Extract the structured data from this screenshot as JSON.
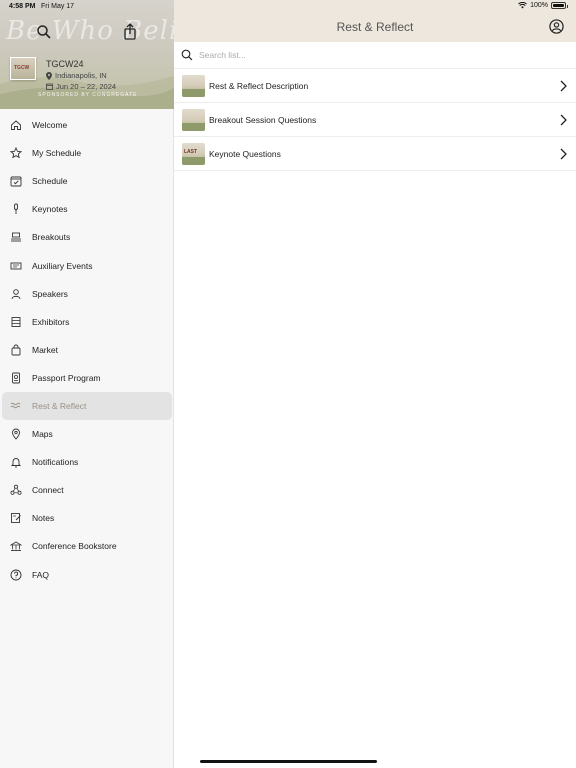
{
  "status_bar": {
    "time": "4:58 PM",
    "date": "Fri May 17",
    "battery": "100%",
    "battery_level": 1.0,
    "wifi_icon": "wifi-icon",
    "battery_icon": "battery-icon"
  },
  "sidebar": {
    "banner": {
      "script_text": "Be Who Believe",
      "conference_name": "TGCW24",
      "location": "Indianapolis, IN",
      "dates": "Jun 20 – 22, 2024",
      "sponsor": "SPONSORED BY CONGREGATE"
    },
    "items": [
      {
        "label": "Welcome",
        "icon": "home-icon"
      },
      {
        "label": "My Schedule",
        "icon": "star-icon"
      },
      {
        "label": "Schedule",
        "icon": "calendar-check-icon"
      },
      {
        "label": "Keynotes",
        "icon": "microphone-icon"
      },
      {
        "label": "Breakouts",
        "icon": "podium-icon"
      },
      {
        "label": "Auxiliary Events",
        "icon": "ticket-icon"
      },
      {
        "label": "Speakers",
        "icon": "person-icon"
      },
      {
        "label": "Exhibitors",
        "icon": "booth-icon"
      },
      {
        "label": "Market",
        "icon": "shopping-bag-icon"
      },
      {
        "label": "Passport Program",
        "icon": "passport-icon"
      },
      {
        "label": "Rest & Reflect",
        "icon": "waves-icon",
        "active": true
      },
      {
        "label": "Maps",
        "icon": "map-pin-icon"
      },
      {
        "label": "Notifications",
        "icon": "bell-icon"
      },
      {
        "label": "Connect",
        "icon": "connect-icon"
      },
      {
        "label": "Notes",
        "icon": "notes-icon"
      },
      {
        "label": "Conference Bookstore",
        "icon": "bookstore-icon"
      },
      {
        "label": "FAQ",
        "icon": "question-icon"
      }
    ]
  },
  "main": {
    "title": "Rest & Reflect",
    "search": {
      "placeholder": "Search list...",
      "value": ""
    },
    "rows": [
      {
        "label": "Rest & Reflect Description",
        "thumb_text": ""
      },
      {
        "label": "Breakout Session Questions",
        "thumb_text": ""
      },
      {
        "label": "Keynote Questions",
        "thumb_text": "LAST"
      }
    ]
  },
  "colors": {
    "header_bg": "#ede7dd",
    "active_item_bg": "#e3e3e3",
    "active_item_text": "#9a8f85"
  }
}
